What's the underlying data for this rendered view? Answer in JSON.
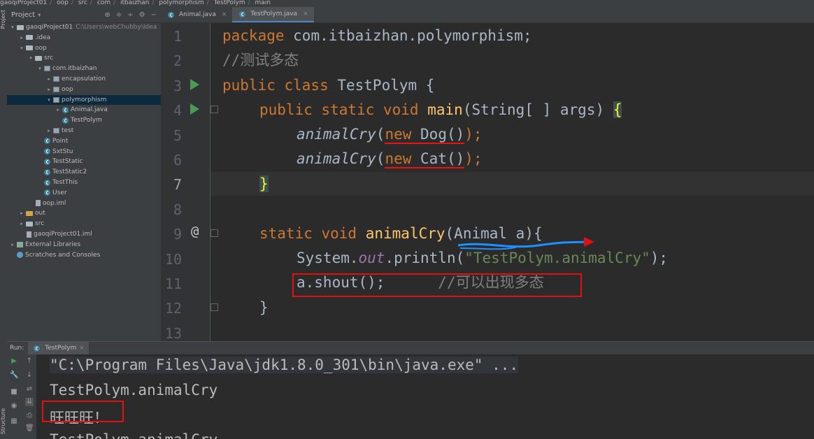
{
  "breadcrumb": [
    "gaoqiProject01",
    "oop",
    "src",
    "com",
    "itbaizhan",
    "polymorphism",
    "TestPolym",
    "main"
  ],
  "project_panel": {
    "title": "Project",
    "tree": [
      {
        "label": "gaoqiProject01",
        "extra": "C:\\Users\\webChubby\\Idea",
        "icon": "folder-icon",
        "depth": 0,
        "expanded": true
      },
      {
        "label": ".idea",
        "icon": "folder-icon",
        "depth": 1,
        "expanded": false
      },
      {
        "label": "oop",
        "icon": "folder-icon",
        "depth": 1,
        "expanded": true
      },
      {
        "label": "src",
        "icon": "folder-icon",
        "depth": 2,
        "expanded": true
      },
      {
        "label": "com.itbaizhan",
        "icon": "package-icon",
        "depth": 3,
        "expanded": true
      },
      {
        "label": "encapsulation",
        "icon": "package-icon",
        "depth": 4,
        "expanded": false
      },
      {
        "label": "oop",
        "icon": "package-icon",
        "depth": 4,
        "expanded": false
      },
      {
        "label": "polymorphism",
        "icon": "package-icon",
        "depth": 4,
        "expanded": true,
        "selected": true
      },
      {
        "label": "Animal.java",
        "icon": "java-class-icon",
        "depth": 5,
        "expanded": false
      },
      {
        "label": "TestPolym",
        "icon": "java-class-icon",
        "depth": 5
      },
      {
        "label": "test",
        "icon": "package-icon",
        "depth": 4,
        "expanded": false
      },
      {
        "label": "Point",
        "icon": "java-class-icon",
        "depth": 3
      },
      {
        "label": "SxtStu",
        "icon": "java-class-icon",
        "depth": 3
      },
      {
        "label": "TestStatic",
        "icon": "java-class-icon",
        "depth": 3
      },
      {
        "label": "TestStatic2",
        "icon": "java-class-icon",
        "depth": 3
      },
      {
        "label": "TestThis",
        "icon": "java-class-icon",
        "depth": 3
      },
      {
        "label": "User",
        "icon": "java-class-icon",
        "depth": 3
      },
      {
        "label": "oop.iml",
        "icon": "file-icon",
        "depth": 2
      },
      {
        "label": "out",
        "icon": "folder-icon",
        "depth": 1,
        "expanded": false,
        "orange": true
      },
      {
        "label": "src",
        "icon": "folder-icon",
        "depth": 1,
        "expanded": false
      },
      {
        "label": "gaoqiProject01.iml",
        "icon": "file-icon",
        "depth": 1
      },
      {
        "label": "External Libraries",
        "icon": "library-icon",
        "depth": 0,
        "expanded": false
      },
      {
        "label": "Scratches and Consoles",
        "icon": "scratch-icon",
        "depth": 0
      }
    ]
  },
  "tabs": [
    {
      "label": "Animal.java",
      "active": false
    },
    {
      "label": "TestPolym.java",
      "active": true
    }
  ],
  "editor": {
    "line_numbers": [
      "1",
      "2",
      "3",
      "4",
      "5",
      "6",
      "7",
      "8",
      "9",
      "10",
      "11",
      "12",
      "13"
    ],
    "lines": {
      "l1_kw": "package",
      "l1_rest": " com.itbaizhan.polymorphism;",
      "l2_comment": "//测试多态",
      "l3_kw": "public class",
      "l3_rest": " TestPolym {",
      "l4_kw": "public static void",
      "l4_fn": "main",
      "l4_rest": "(String[ ] args) ",
      "l4_brace": "{",
      "l5_call": "animalCry",
      "l5_open": "(",
      "l5_new": "new",
      "l5_arg": " Dog()",
      "l5_end": ");",
      "l6_call": "animalCry",
      "l6_open": "(",
      "l6_new": "new",
      "l6_arg": " Cat()",
      "l6_end": ");",
      "l7_brace": "}",
      "l9_kw": "static void",
      "l9_fn": "animalCry",
      "l9_rest": "(Animal a){",
      "l10_a": "System.",
      "l10_out": "out",
      "l10_b": ".println(",
      "l10_str": "\"TestPolym.animalCry\"",
      "l10_c": ");",
      "l11_code": "a.shout();",
      "l11_comment": "//可以出现多态",
      "l12_brace": "}"
    }
  },
  "run_panel": {
    "label": "Run:",
    "tab": "TestPolym",
    "console_lines": [
      "\"C:\\Program Files\\Java\\jdk1.8.0_301\\bin\\java.exe\" ...",
      "TestPolym.animalCry",
      "旺旺旺！",
      "TestPolym.animalCry"
    ]
  },
  "side_labels": {
    "project": "Project",
    "structure": "Structure"
  },
  "colors": {
    "annotation_red": "#e11111",
    "annotation_blue": "#1e90ff",
    "run_green": "#499c54",
    "keyword": "#cc7832"
  }
}
